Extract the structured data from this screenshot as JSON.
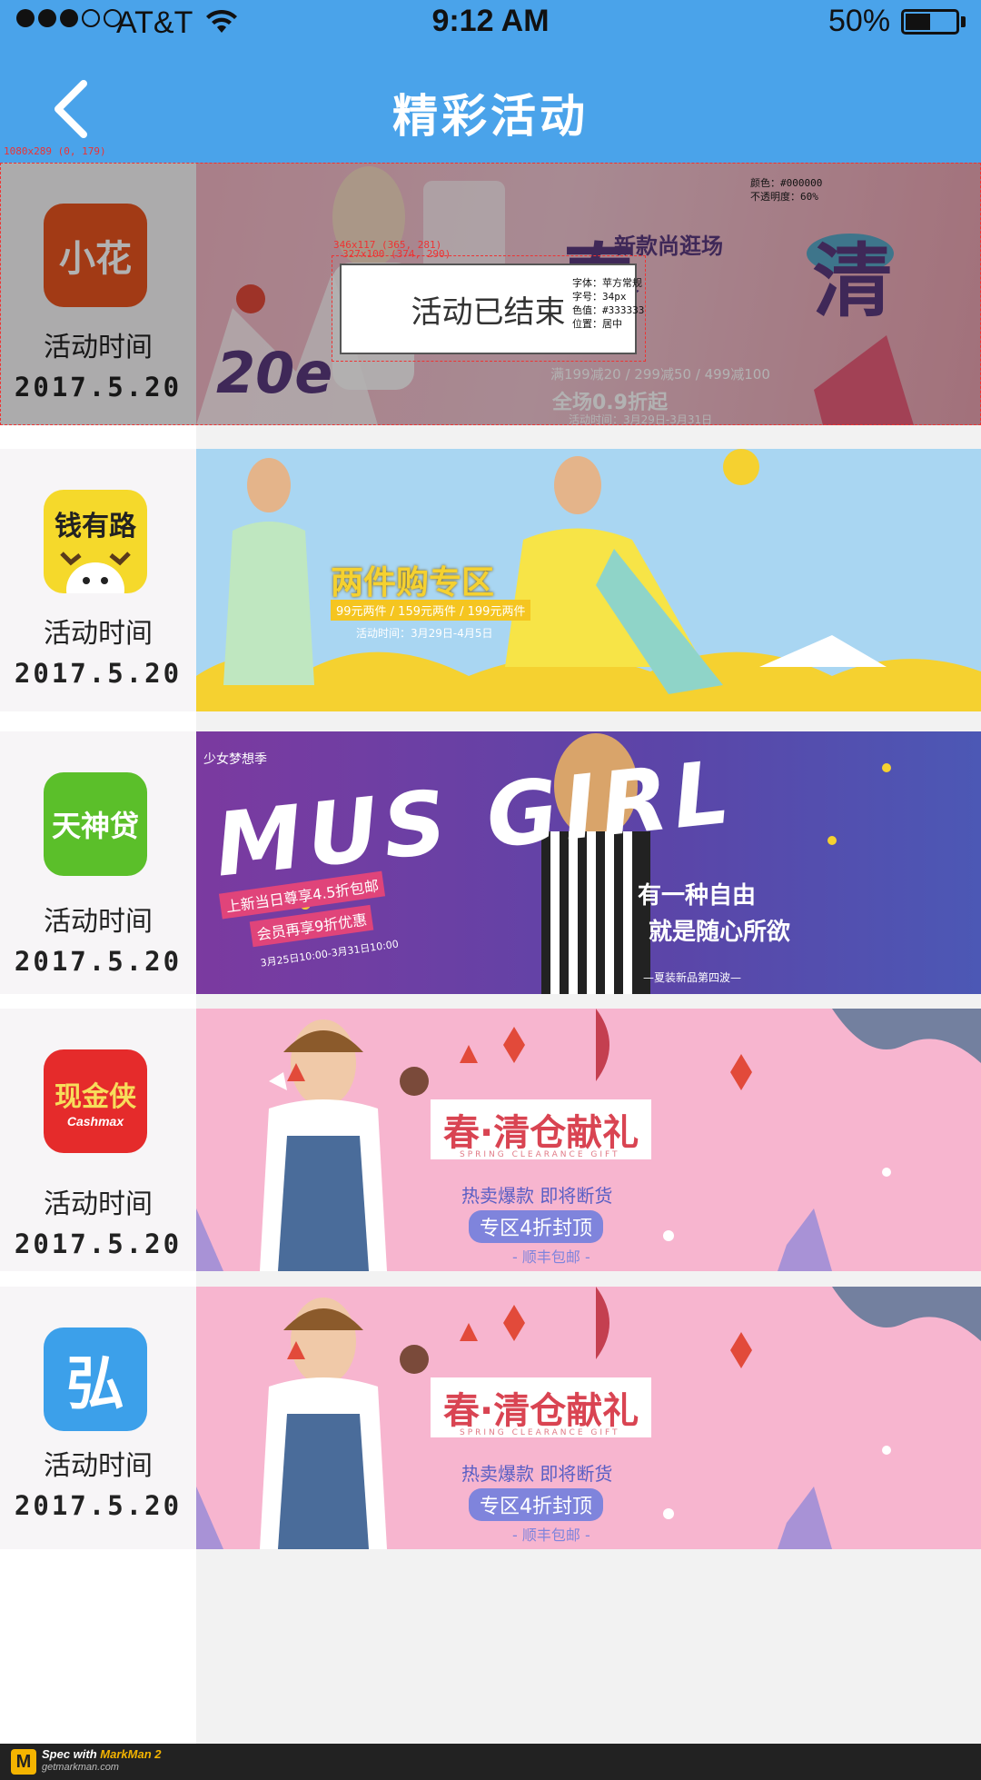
{
  "statusbar": {
    "carrier": "AT&T",
    "time": "9:12 AM",
    "battery_pct": "50%",
    "battery_level": 0.5
  },
  "header": {
    "title": "精彩活动",
    "back_icon": "chevron-left-icon"
  },
  "rows": [
    {
      "app_name": "小花",
      "logo_bg": "#e8531f",
      "label": "活动时间",
      "date": "2017.5.20",
      "banner_bg": "#e9a2b0",
      "banner_title": "春 清",
      "banner_text1": "新款尚逛场",
      "banner_text2": "满199减20 / 299减50 / 499减100",
      "banner_text3": "全场0.9折起",
      "banner_text4": "活动时间：3月29日-3月31日",
      "banner_badge": "20e",
      "ended": true
    },
    {
      "app_name": "钱有路",
      "logo_bg": "#f5d92b",
      "label": "活动时间",
      "date": "2017.5.20",
      "banner_bg": "#a9d6f2",
      "banner_title": "两件购专区",
      "banner_text1": "99元两件 / 159元两件 / 199元两件",
      "banner_text2": "活动时间：3月29日-4月5日"
    },
    {
      "app_name": "天神贷",
      "logo_bg": "#5bbf2a",
      "label": "活动时间",
      "date": "2017.5.20",
      "banner_bg": "#6b3fa0",
      "banner_title": "MUS GIRL",
      "banner_text1": "少女梦想季",
      "banner_text2": "上新当日尊享4.5折包邮",
      "banner_text3": "会员再享9折优惠",
      "banner_text4": "3月25日10:00-3月31日10:00",
      "banner_text5": "有一种自由",
      "banner_text6": "就是随心所欲",
      "banner_text7": "—夏装新品第四波—"
    },
    {
      "app_name": "现金侠",
      "app_sub": "Cashmax",
      "logo_bg": "#e52b2b",
      "label": "活动时间",
      "date": "2017.5.20",
      "banner_bg": "#f7b5cf",
      "banner_title": "春·清仓献礼",
      "banner_text1": "SPRING CLEARANCE GIFT",
      "banner_text2": "热卖爆款  即将断货",
      "banner_text3": "专区4折封顶",
      "banner_text4": "- 顺丰包邮 -"
    },
    {
      "app_name": "弘",
      "logo_bg": "#3ca0ea",
      "label": "活动时间",
      "date": "2017.5.20",
      "banner_bg": "#f7b5cf",
      "banner_title": "春·清仓献礼",
      "banner_text1": "SPRING CLEARANCE GIFT",
      "banner_text2": "热卖爆款  即将断货",
      "banner_text3": "专区4折封顶",
      "banner_text4": "- 顺丰包邮 -"
    }
  ],
  "ended_box": {
    "text": "活动已结束"
  },
  "spec": {
    "row_size": "1080x289 (0, 179)",
    "outer_size": "346x117 (365, 281)",
    "inner_size": "327x100 (374, 290)",
    "note_font": "字体：苹方常规\n字号：34px\n色值：#333333\n位置：居中",
    "note_overlay": "颜色：#000000\n不透明度：60%"
  },
  "footer": {
    "logo": "M",
    "spec_with": "Spec with ",
    "brand": "MarkMan 2",
    "url": "getmarkman.com"
  }
}
